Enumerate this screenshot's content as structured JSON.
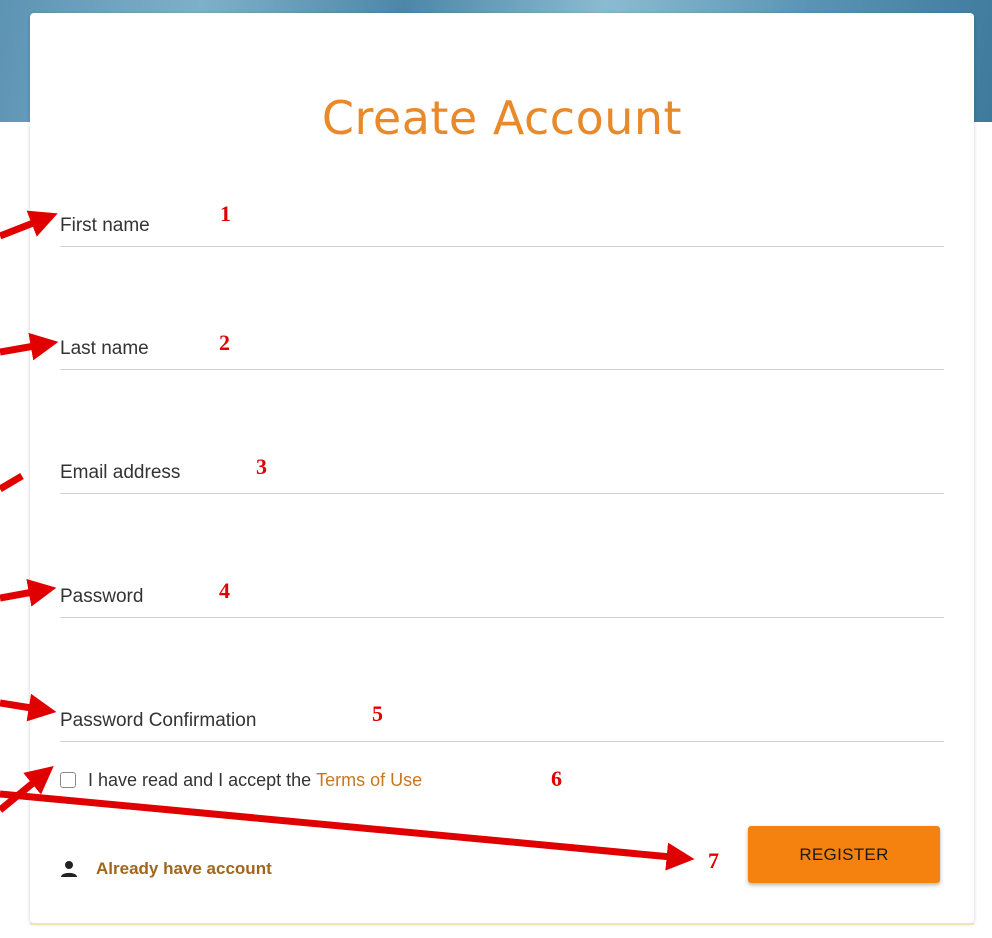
{
  "form": {
    "title": "Create Account",
    "fields": [
      {
        "placeholder": "First name",
        "value": ""
      },
      {
        "placeholder": "Last name",
        "value": ""
      },
      {
        "placeholder": "Email address",
        "value": ""
      },
      {
        "placeholder": "Password",
        "value": ""
      },
      {
        "placeholder": "Password Confirmation",
        "value": ""
      }
    ],
    "terms": {
      "text": "I have read and I accept the",
      "link": "Terms of Use",
      "checked": false
    },
    "login_link": "Already have account",
    "register_label": "REGISTER"
  },
  "annotations": {
    "numbers": [
      "1",
      "2",
      "3",
      "4",
      "5",
      "6",
      "7"
    ],
    "color": "#e00000"
  },
  "colors": {
    "accent": "#e88a2a",
    "button": "#f5820f",
    "link": "#a0661b"
  },
  "icons": {
    "user": "user-icon",
    "arrow": "arrow-icon"
  }
}
